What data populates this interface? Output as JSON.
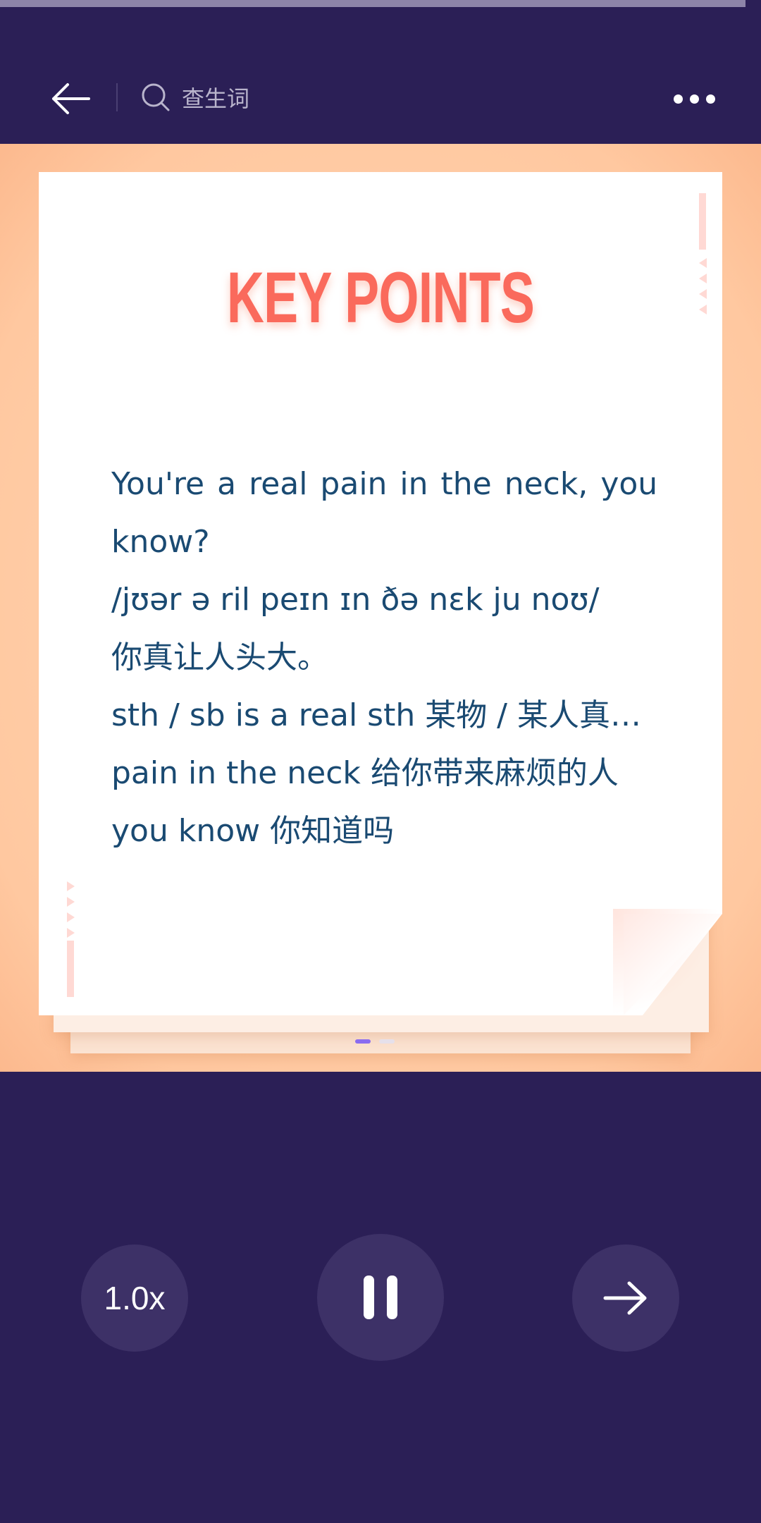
{
  "playback": {
    "progress_fraction": 0.98
  },
  "header": {
    "search_label": "查生词"
  },
  "card": {
    "title": "KEY POINTS",
    "lines": [
      "You're a real pain in the neck, you know?",
      "/jʊər ə ril peɪn ɪn ðə nɛk ju noʊ/",
      "你真让人头大。",
      "sth / sb is a real sth 某物 / 某人真…",
      "pain in the neck 给你带来麻烦的人",
      "you know 你知道吗"
    ],
    "page_count": 2,
    "active_page": 1
  },
  "controls": {
    "speed_label": "1.0x"
  },
  "colors": {
    "background": "#2b1f56",
    "accent": "#fa6a5c",
    "text": "#1a4a72",
    "dot_active": "#8a6cf0",
    "dot_inactive": "#e6e0ea"
  }
}
